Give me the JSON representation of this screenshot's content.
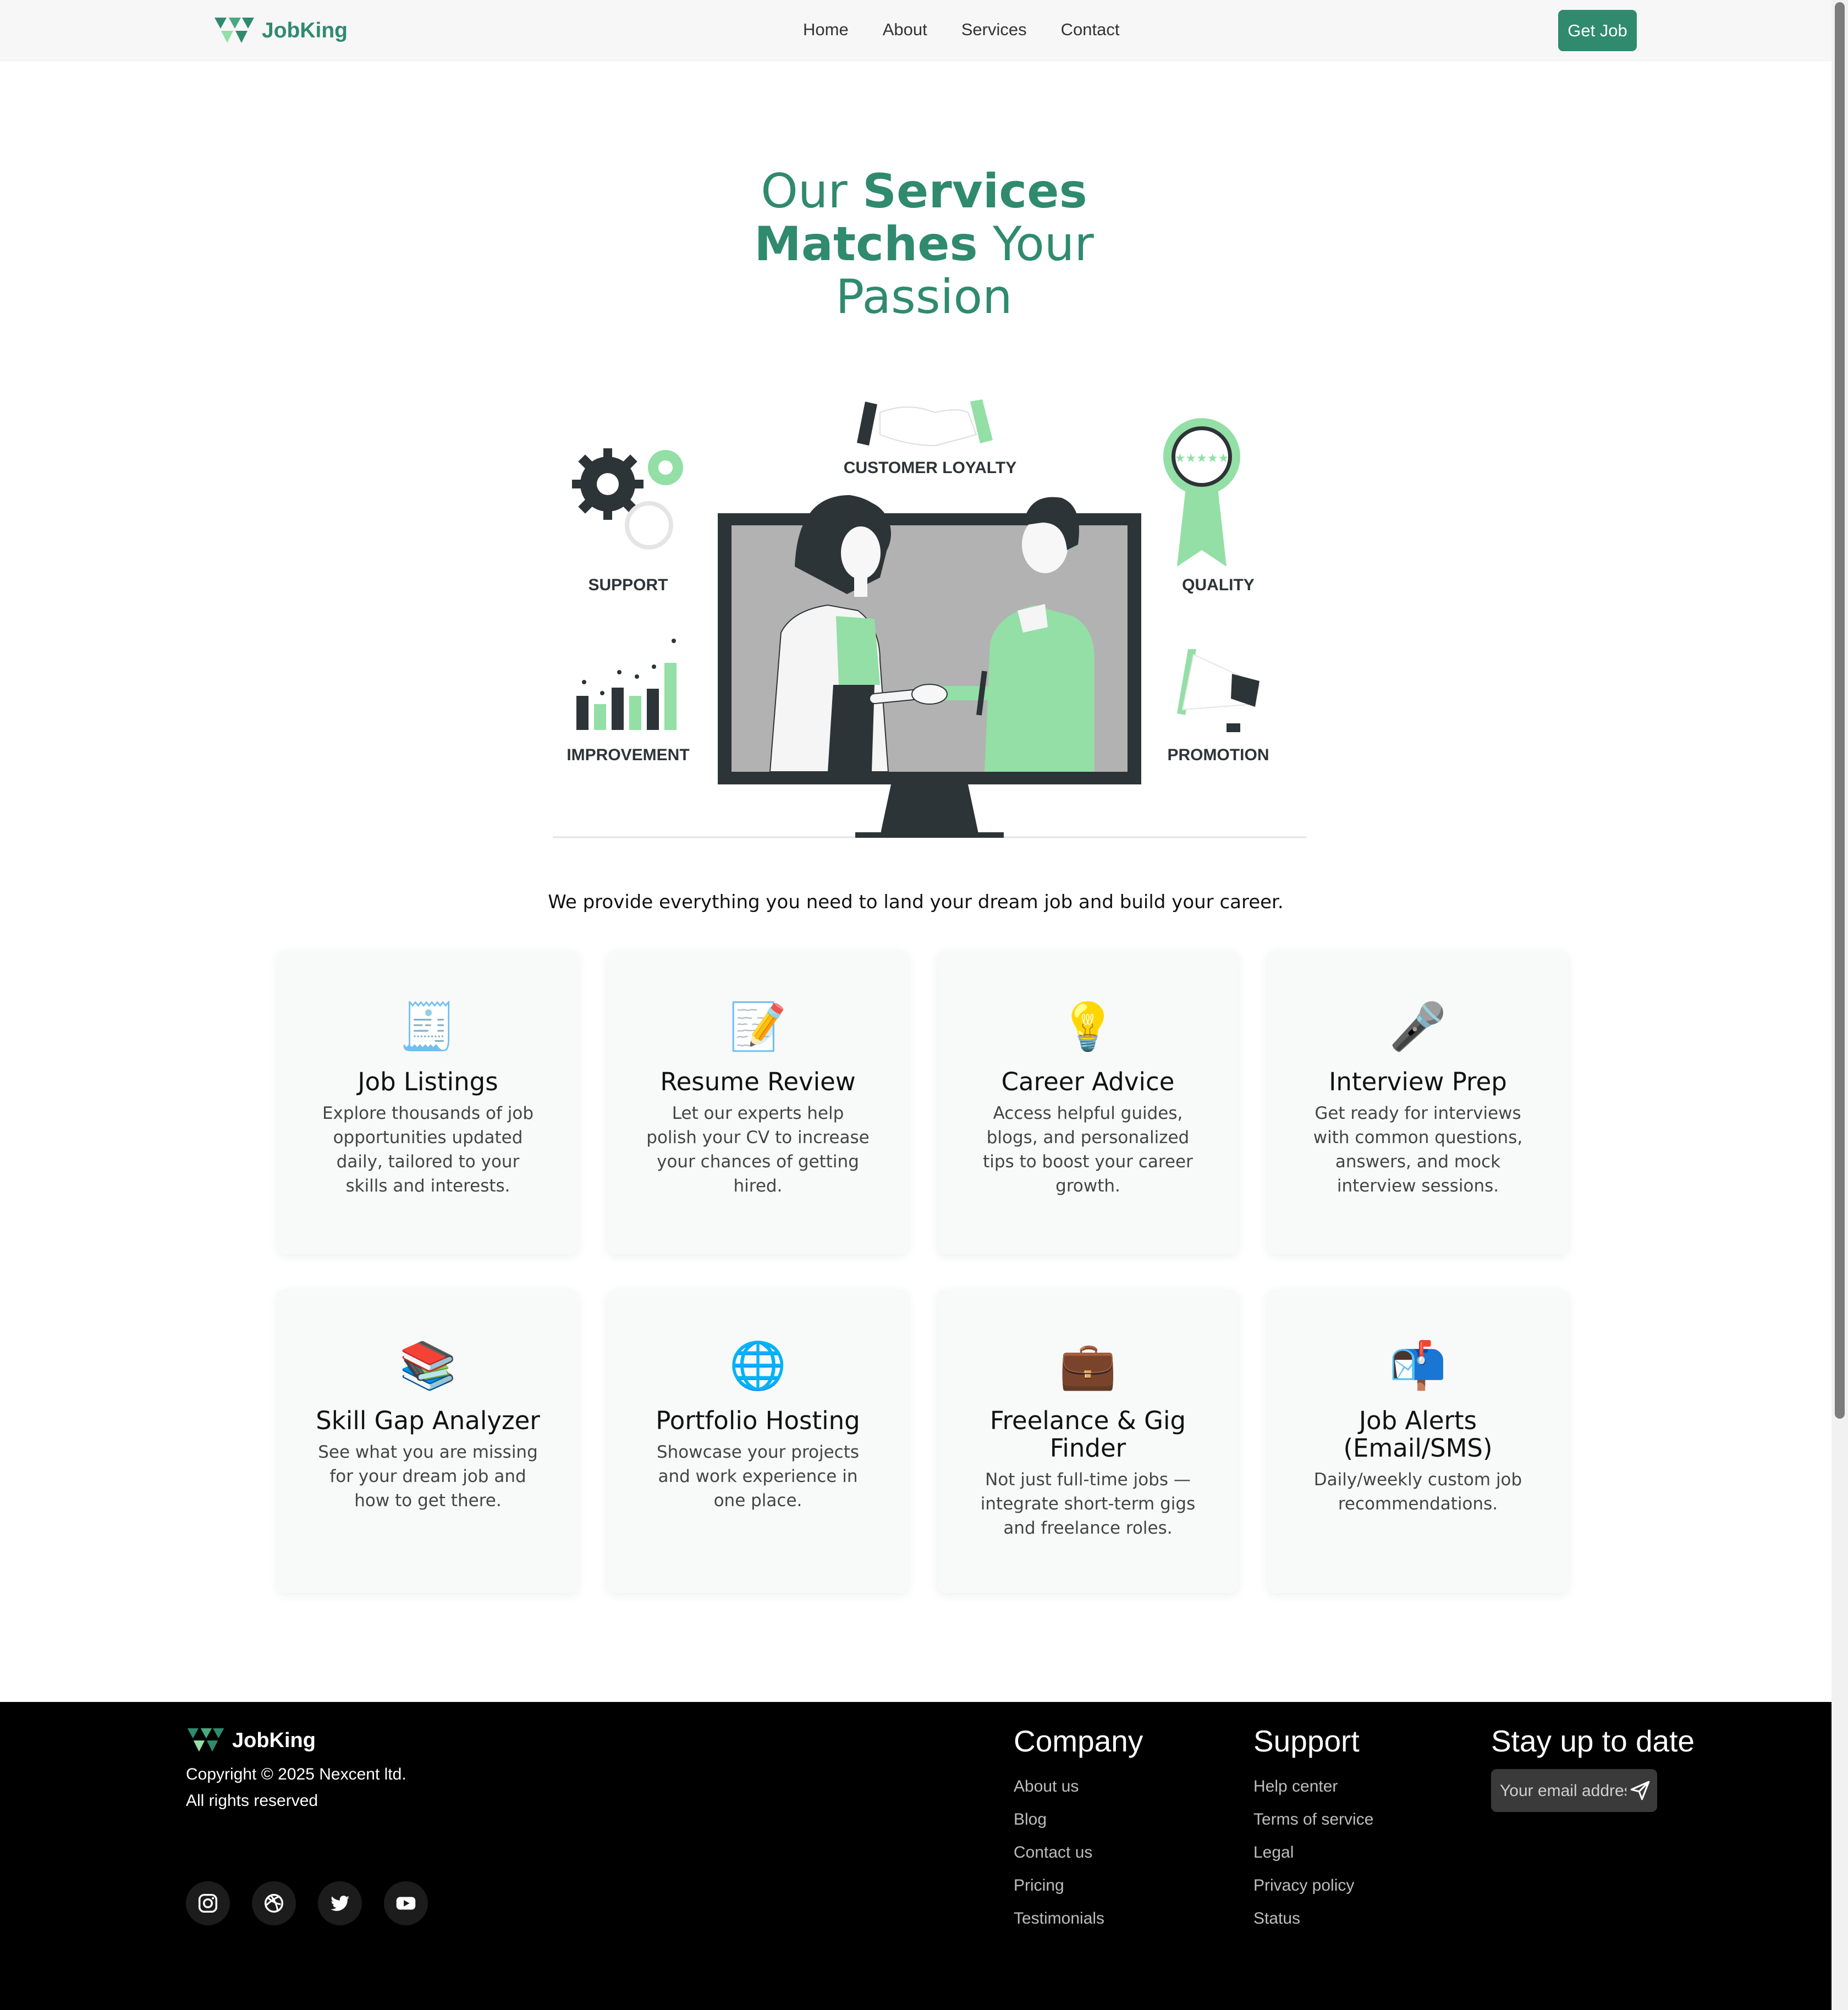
{
  "nav": {
    "brand": "JobKing",
    "links": [
      "Home",
      "About",
      "Services",
      "Contact"
    ],
    "cta": "Get Job"
  },
  "hero": {
    "line1_regular": "Our ",
    "line1_bold": "Services",
    "line2_bold": "Matches",
    "line2_regular": " Your",
    "line3": "Passion",
    "illustration_labels": [
      "CUSTOMER LOYALTY",
      "SUPPORT",
      "QUALITY",
      "IMPROVEMENT",
      "PROMOTION"
    ],
    "tagline": "We provide everything you need to land your dream job and build your career."
  },
  "services": [
    {
      "icon": "receipt-icon",
      "glyph": "🧾",
      "title": "Job Listings",
      "desc": "Explore thousands of job opportunities updated daily, tailored to your skills and interests."
    },
    {
      "icon": "memo-icon",
      "glyph": "📝",
      "title": "Resume Review",
      "desc": "Let our experts help polish your CV to increase your chances of getting hired."
    },
    {
      "icon": "lightbulb-icon",
      "glyph": "💡",
      "title": "Career Advice",
      "desc": "Access helpful guides, blogs, and personalized tips to boost your career growth."
    },
    {
      "icon": "microphone-icon",
      "glyph": "🎤",
      "title": "Interview Prep",
      "desc": "Get ready for interviews with common questions, answers, and mock interview sessions."
    },
    {
      "icon": "books-icon",
      "glyph": "📚",
      "title": "Skill Gap Analyzer",
      "desc": "See what you are missing for your dream job and how to get there."
    },
    {
      "icon": "globe-icon",
      "glyph": "🌐",
      "title": "Portfolio Hosting",
      "desc": "Showcase your projects and work experience in one place."
    },
    {
      "icon": "briefcase-icon",
      "glyph": "💼",
      "title": "Freelance & Gig Finder",
      "desc": "Not just full-time jobs — integrate short-term gigs and freelance roles."
    },
    {
      "icon": "mailbox-icon",
      "glyph": "📬",
      "title": "Job Alerts (Email/SMS)",
      "desc": "Daily/weekly custom job recommendations."
    }
  ],
  "footer": {
    "brand": "JobKing",
    "copyright": "Copyright © 2025 Nexcent ltd.",
    "rights": "All rights reserved",
    "socials": [
      "instagram-icon",
      "dribbble-icon",
      "twitter-icon",
      "youtube-icon"
    ],
    "company": {
      "title": "Company",
      "links": [
        "About us",
        "Blog",
        "Contact us",
        "Pricing",
        "Testimonials"
      ]
    },
    "support": {
      "title": "Support",
      "links": [
        "Help center",
        "Terms of service",
        "Legal",
        "Privacy policy",
        "Status"
      ]
    },
    "newsletter": {
      "title": "Stay up to date",
      "placeholder": "Your email address"
    }
  },
  "colors": {
    "brand": "#2f8a6e",
    "accent_light": "#93dfa6",
    "dark": "#2d3437",
    "footer_bg": "#000000"
  }
}
